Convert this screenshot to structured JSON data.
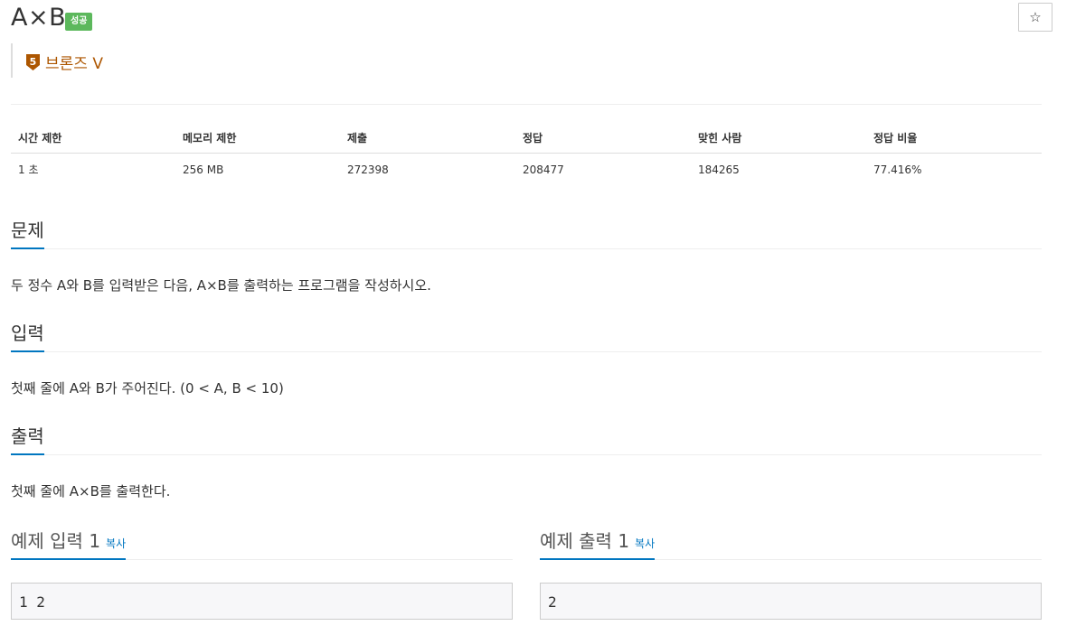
{
  "problem": {
    "title": "A×B",
    "status_badge": "성공",
    "tier_label": "브론즈 V",
    "tier_number": "5",
    "star_symbol": "☆",
    "tier_color": "#ad5600",
    "badge_color": "#5cb85c",
    "accent_color": "#0076c0"
  },
  "info_table": {
    "headers": [
      "시간 제한",
      "메모리 제한",
      "제출",
      "정답",
      "맞힌 사람",
      "정답 비율"
    ],
    "values": [
      "1 초",
      "256 MB",
      "272398",
      "208477",
      "184265",
      "77.416%"
    ]
  },
  "sections": {
    "description": {
      "heading": "문제",
      "text": "두 정수 A와 B를 입력받은 다음, A×B를 출력하는 프로그램을 작성하시오."
    },
    "input": {
      "heading": "입력",
      "text": "첫째 줄에 A와 B가 주어진다. (0 < A, B < 10)"
    },
    "output": {
      "heading": "출력",
      "text": "첫째 줄에 A×B를 출력한다."
    }
  },
  "samples": {
    "input": {
      "heading": "예제 입력 1",
      "copy_label": "복사",
      "content": "1 2"
    },
    "output": {
      "heading": "예제 출력 1",
      "copy_label": "복사",
      "content": "2"
    }
  }
}
